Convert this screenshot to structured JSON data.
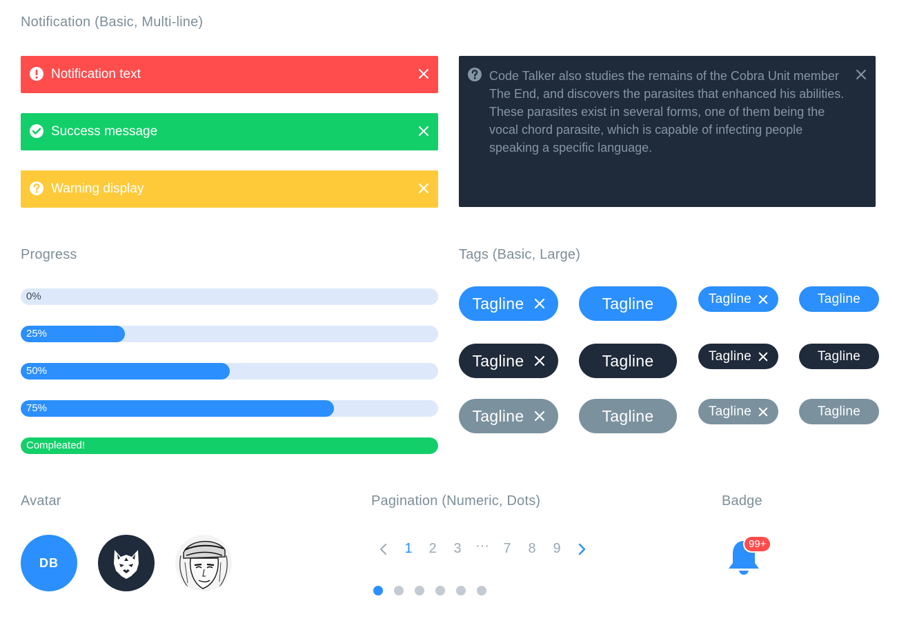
{
  "notifications": {
    "title": "Notification (Basic, Multi-line)",
    "error_text": "Notification text",
    "success_text": "Success message",
    "warning_text": "Warning display",
    "multiline_text": "Code Talker also studies the remains of the Cobra Unit member The End, and discovers the parasites that enhanced his abilities. These parasites exist in several forms, one of them being the vocal chord parasite, which is capable of infecting people speaking a specific language.",
    "colors": {
      "error": "#ff4d4d",
      "success": "#13cf69",
      "warning": "#ffca3a",
      "dark": "#1f2a3a"
    }
  },
  "progress": {
    "title": "Progress",
    "bars": [
      {
        "label": "0%",
        "value": 0
      },
      {
        "label": "25%",
        "value": 25
      },
      {
        "label": "50%",
        "value": 50
      },
      {
        "label": "75%",
        "value": 75
      },
      {
        "label": "Compleated!",
        "value": 100
      }
    ]
  },
  "tags": {
    "title": "Tags (Basic, Large)",
    "label": "Tagline",
    "colors": {
      "blue": "#2b8ffd",
      "dark": "#1f2a3a",
      "grey": "#7b919e"
    }
  },
  "avatar": {
    "title": "Avatar",
    "initials": "DB",
    "icons": [
      "wolf-icon",
      "portrait-photo"
    ]
  },
  "pagination": {
    "title": "Pagination (Numeric, Dots)",
    "pages": [
      "1",
      "2",
      "3",
      "···",
      "7",
      "8",
      "9"
    ],
    "current_page": "1",
    "dots_count": 6,
    "active_dot": 1
  },
  "badge": {
    "title": "Badge",
    "count": "99+",
    "icon": "bell-icon"
  }
}
